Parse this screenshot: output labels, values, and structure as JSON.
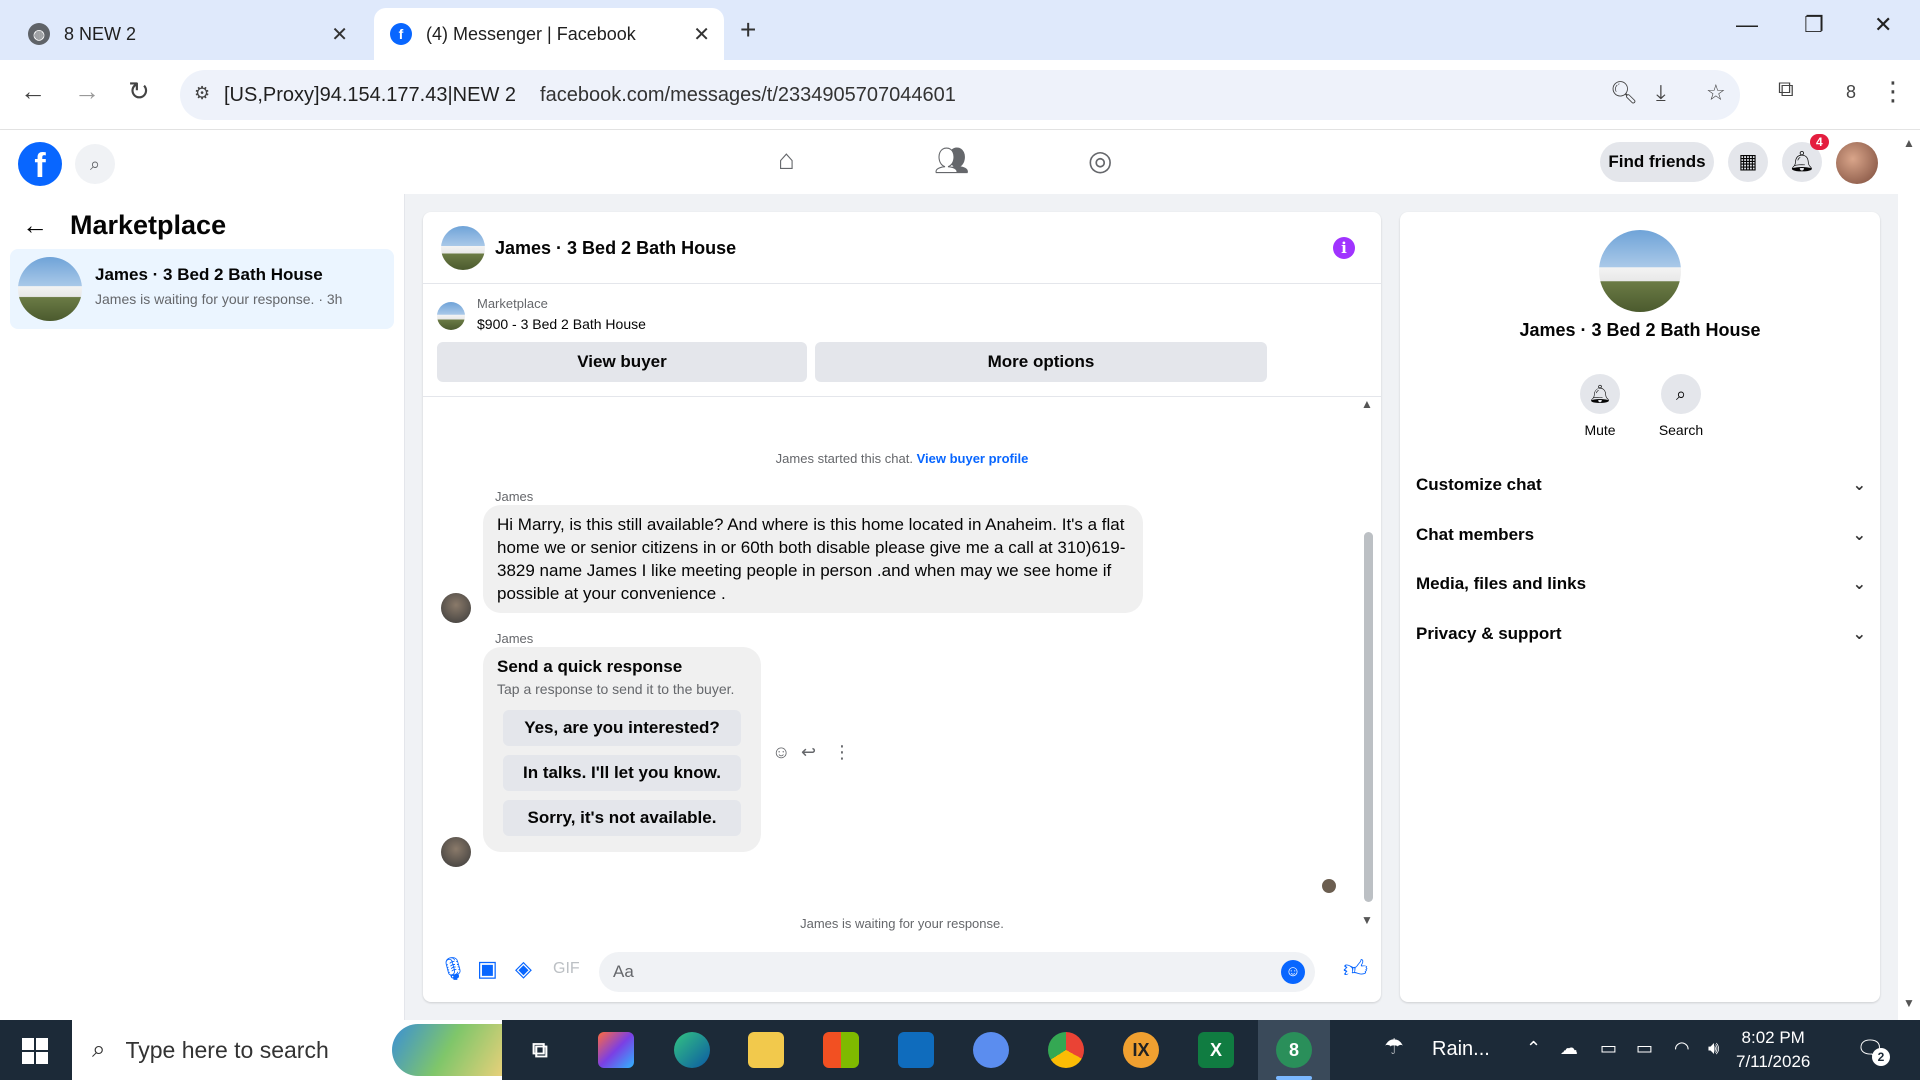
{
  "browser": {
    "tabs": [
      {
        "title": "8 NEW 2",
        "active": false
      },
      {
        "title": "(4) Messenger | Facebook",
        "active": true
      }
    ],
    "proxy_label": "[US,Proxy]94.154.177.43|NEW 2",
    "url": "facebook.com/messages/t/2334905707044601",
    "profile_count": "8"
  },
  "fb_header": {
    "find_friends_label": "Find friends",
    "notification_count": "4"
  },
  "left_panel": {
    "title": "Marketplace",
    "conversations": [
      {
        "name": "James · 3 Bed 2 Bath House",
        "preview": "James is waiting for your response. · 3h"
      }
    ]
  },
  "chat": {
    "title": "James · 3 Bed 2 Bath House",
    "marketplace_label": "Marketplace",
    "listing": "$900 - 3 Bed 2 Bath House",
    "view_buyer_label": "View buyer",
    "more_options_label": "More options",
    "started_text": "James started this chat.",
    "view_profile_link": "View buyer profile",
    "messages": [
      {
        "sender": "James",
        "text": "Hi Marry, is this still available? And where is this home located in Anaheim. It's a flat home we or senior citizens  in or 60th both disable  please give me a call at 310)619-3829  name James  I like meeting  people in person .and when may we see home if possible  at your convenience  ."
      },
      {
        "sender": "James"
      }
    ],
    "quick_response": {
      "title": "Send a quick response",
      "subtitle": "Tap a response to send it to the buyer.",
      "options": [
        "Yes, are you interested?",
        "In talks. I'll let you know.",
        "Sorry, it's not available."
      ]
    },
    "waiting_text": "James is waiting for your response.",
    "composer_placeholder": "Aa"
  },
  "right_panel": {
    "title": "James · 3 Bed 2 Bath House",
    "mute_label": "Mute",
    "search_label": "Search",
    "sections": [
      "Customize chat",
      "Chat members",
      "Media, files and links",
      "Privacy & support"
    ]
  },
  "taskbar": {
    "search_placeholder": "Type here to search",
    "weather": "Rain...",
    "time": "8:02 PM",
    "date": "7/11/2026",
    "notification_count": "2"
  }
}
